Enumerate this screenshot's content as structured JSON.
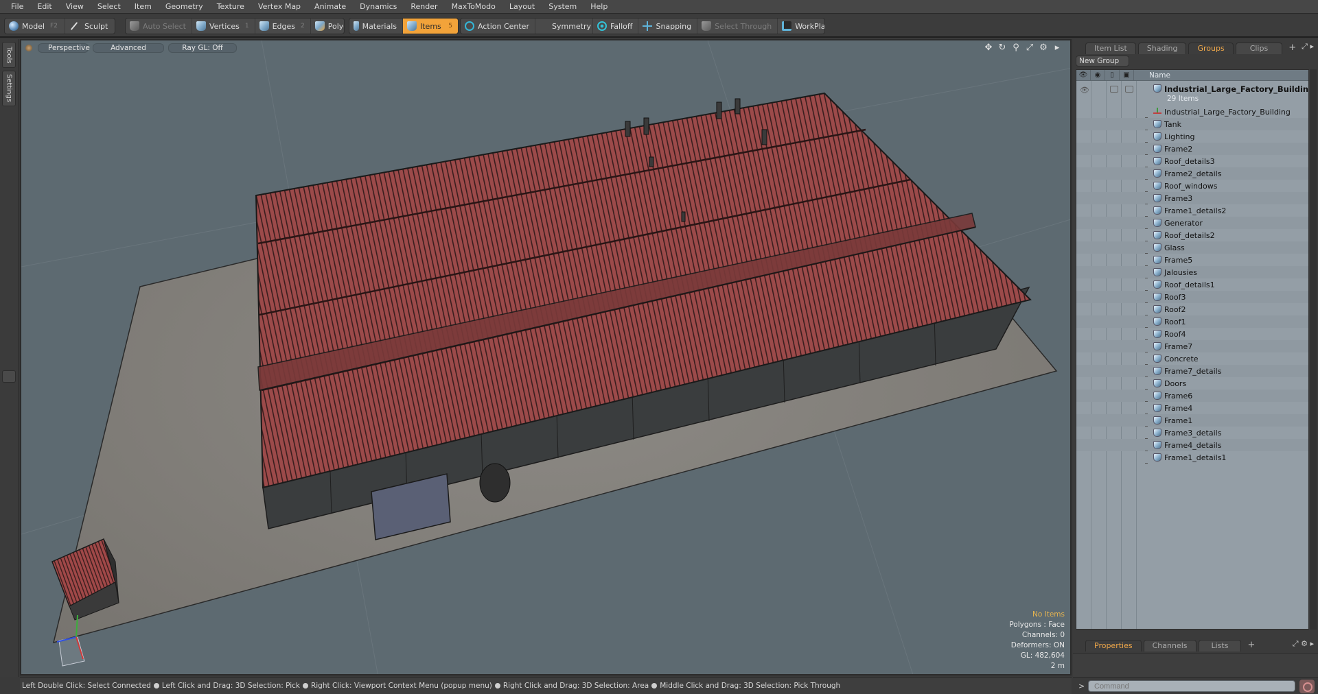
{
  "menubar": {
    "items": [
      "File",
      "Edit",
      "View",
      "Select",
      "Item",
      "Geometry",
      "Texture",
      "Vertex Map",
      "Animate",
      "Dynamics",
      "Render",
      "MaxToModo",
      "Layout",
      "System",
      "Help"
    ]
  },
  "toolbar": {
    "model": {
      "label": "Model",
      "key": "F2"
    },
    "sculpt": {
      "label": "Sculpt"
    },
    "auto_select": {
      "label": "Auto Select"
    },
    "vertices": {
      "label": "Vertices",
      "key": "1"
    },
    "edges": {
      "label": "Edges",
      "key": "2"
    },
    "polygons": {
      "label": "Polygons"
    },
    "materials": {
      "label": "Materials"
    },
    "items": {
      "label": "Items",
      "key": "5"
    },
    "action_center": {
      "label": "Action Center"
    },
    "symmetry": {
      "label": "Symmetry"
    },
    "falloff": {
      "label": "Falloff"
    },
    "snapping": {
      "label": "Snapping"
    },
    "select_through": {
      "label": "Select Through"
    },
    "workplane": {
      "label": "WorkPlane"
    },
    "active_color": "#f2a33a"
  },
  "left_tabs": [
    "Tools",
    "Settings"
  ],
  "viewport": {
    "view_mode": "Perspective",
    "shading": "Advanced",
    "raygl": "Ray GL: Off",
    "info": {
      "selection": "No Items",
      "polygons": "Polygons : Face",
      "channels": "Channels: 0",
      "deformers": "Deformers: ON",
      "gl": "GL: 482,604",
      "scale": "2 m"
    },
    "tool_icons": [
      "move-view-icon",
      "rotate-view-icon",
      "zoom-view-icon",
      "maximize-icon",
      "gear-icon",
      "arrow-right-icon"
    ]
  },
  "right_panel": {
    "tabs": [
      {
        "label": "Item List",
        "active": false
      },
      {
        "label": "Shading",
        "active": false
      },
      {
        "label": "Groups",
        "active": true
      },
      {
        "label": "Clips",
        "active": false
      }
    ],
    "add_tab": "+",
    "new_group_label": "New Group",
    "columns": {
      "name": "Name"
    },
    "group": {
      "name": "Industrial_Large_Factory_Building...",
      "count": "29 Items"
    },
    "items": [
      {
        "name": "Industrial_Large_Factory_Building",
        "type": "locator"
      },
      {
        "name": "Tank",
        "type": "mesh"
      },
      {
        "name": "Lighting",
        "type": "mesh"
      },
      {
        "name": "Frame2",
        "type": "mesh"
      },
      {
        "name": "Roof_details3",
        "type": "mesh"
      },
      {
        "name": "Frame2_details",
        "type": "mesh"
      },
      {
        "name": "Roof_windows",
        "type": "mesh"
      },
      {
        "name": "Frame3",
        "type": "mesh"
      },
      {
        "name": "Frame1_details2",
        "type": "mesh"
      },
      {
        "name": "Generator",
        "type": "mesh"
      },
      {
        "name": "Roof_details2",
        "type": "mesh"
      },
      {
        "name": "Glass",
        "type": "mesh"
      },
      {
        "name": "Frame5",
        "type": "mesh"
      },
      {
        "name": "Jalousies",
        "type": "mesh"
      },
      {
        "name": "Roof_details1",
        "type": "mesh"
      },
      {
        "name": "Roof3",
        "type": "mesh"
      },
      {
        "name": "Roof2",
        "type": "mesh"
      },
      {
        "name": "Roof1",
        "type": "mesh"
      },
      {
        "name": "Roof4",
        "type": "mesh"
      },
      {
        "name": "Frame7",
        "type": "mesh"
      },
      {
        "name": "Concrete",
        "type": "mesh"
      },
      {
        "name": "Frame7_details",
        "type": "mesh"
      },
      {
        "name": "Doors",
        "type": "mesh"
      },
      {
        "name": "Frame6",
        "type": "mesh"
      },
      {
        "name": "Frame4",
        "type": "mesh"
      },
      {
        "name": "Frame1",
        "type": "mesh"
      },
      {
        "name": "Frame3_details",
        "type": "mesh"
      },
      {
        "name": "Frame4_details",
        "type": "mesh"
      },
      {
        "name": "Frame1_details1",
        "type": "mesh"
      }
    ],
    "bottom_tabs": [
      {
        "label": "Properties",
        "active": true
      },
      {
        "label": "Channels",
        "active": false
      },
      {
        "label": "Lists",
        "active": false
      }
    ]
  },
  "command": {
    "prompt": ">",
    "placeholder": "Command"
  },
  "statusbar": {
    "hints": [
      "Left Double Click: Select Connected",
      "Left Click and Drag: 3D Selection: Pick",
      "Right Click: Viewport Context Menu (popup menu)",
      "Right Click and Drag: 3D Selection: Area",
      "Middle Click and Drag: 3D Selection: Pick Through"
    ]
  }
}
